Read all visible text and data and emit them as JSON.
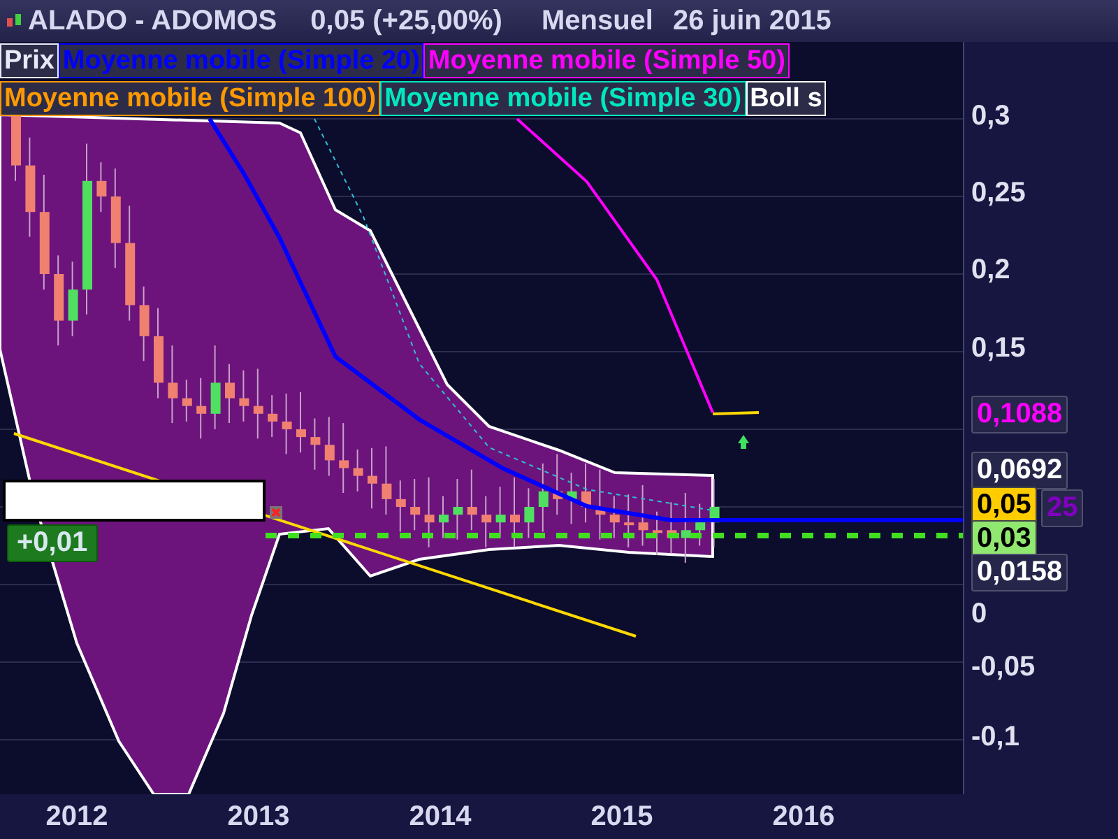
{
  "header": {
    "symbol": "ALADO - ADOMOS",
    "quote": "0,05 (+25,00%)",
    "period": "Mensuel",
    "date": "26 juin 2015"
  },
  "legend": [
    [
      {
        "label": "Prix",
        "color": "#e8e8f8"
      },
      {
        "label": "Moyenne mobile (Simple 20)",
        "color": "#0000ff"
      },
      {
        "label": "Moyenne mobile (Simple 50)",
        "color": "#ff00ff"
      }
    ],
    [
      {
        "label": "Moyenne mobile (Simple 100)",
        "color": "#ff9900"
      },
      {
        "label": "Moyenne mobile (Simple 30)",
        "color": "#00e8c0"
      },
      {
        "label": "Boll s",
        "color": "#ffffff"
      }
    ]
  ],
  "price_axis": {
    "ticks": [
      "0,3",
      "0,25",
      "0,2",
      "0,15",
      "0",
      "-0,05",
      "-0,1"
    ]
  },
  "price_tags": [
    {
      "text": "0,1088",
      "kind": "outline",
      "color": "#ff00ff"
    },
    {
      "text": "0,0692",
      "kind": "outline",
      "color": "#ffffff"
    },
    {
      "text": "0,05",
      "kind": "filled",
      "color": "#ffcc00"
    },
    {
      "text": "25",
      "kind": "outline",
      "color": "#8000c0"
    },
    {
      "text": "0,03",
      "kind": "filled",
      "color": "#90e870"
    },
    {
      "text": "0,0158",
      "kind": "outline",
      "color": "#ffffff"
    }
  ],
  "change_badge": "+0,01",
  "time_axis": {
    "ticks": [
      "2012",
      "2013",
      "2014",
      "2015",
      "2016"
    ]
  }
}
